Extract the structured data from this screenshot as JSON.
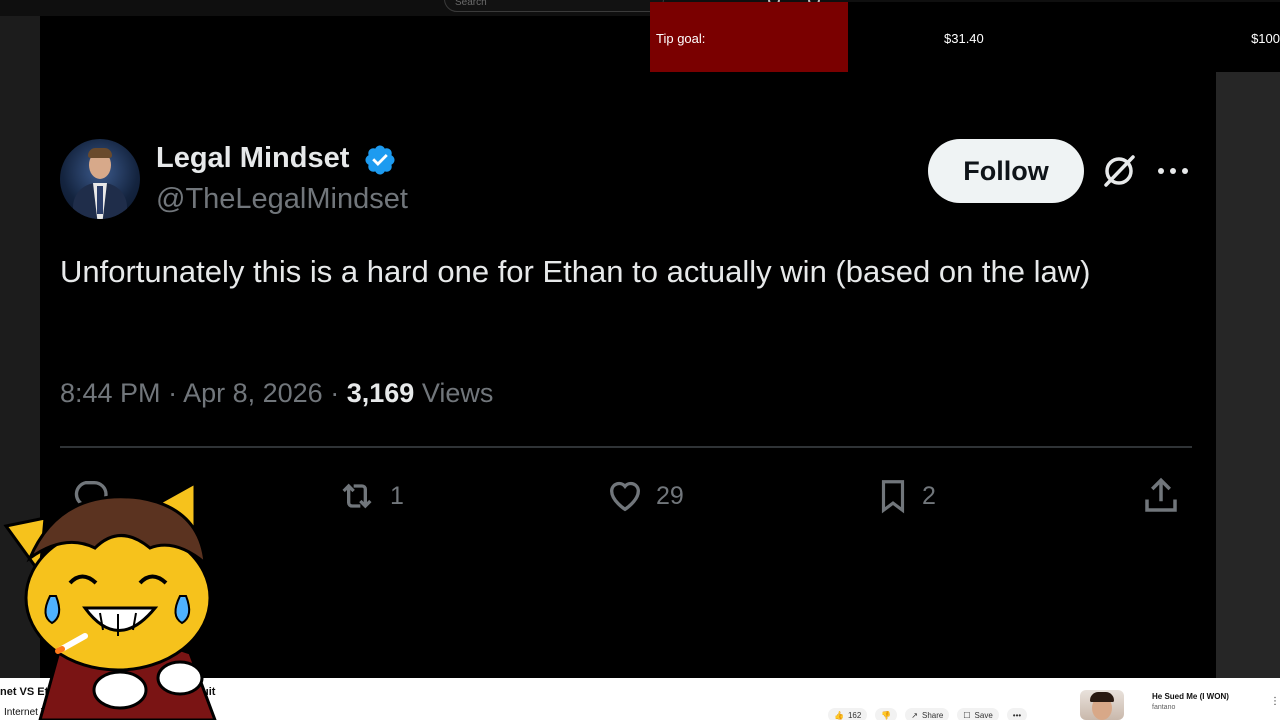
{
  "browser": {
    "search_placeholder": "Search"
  },
  "tip_goal": {
    "label": "Tip goal:",
    "current": "$31.40",
    "target": "$100",
    "progress": 0.314,
    "fill_color": "#7a0000"
  },
  "tweet": {
    "display_name": "Legal Mindset",
    "handle": "@TheLegalMindset",
    "verified": true,
    "follow_label": "Follow",
    "text": "Unfortunately this is a hard one for Ethan to actually win (based on the law)",
    "time": "8:44 PM",
    "separator": "·",
    "date": "Apr 8, 2026",
    "views_count": "3,169",
    "views_label": "Views",
    "actions": {
      "reply_icon": "reply-icon",
      "retweet_icon": "retweet-icon",
      "retweet_count": "1",
      "like_icon": "heart-icon",
      "like_count": "29",
      "bookmark_icon": "bookmark-icon",
      "bookmark_count": "2",
      "share_icon": "share-icon"
    },
    "accent_color": "#1d9bf0"
  },
  "youtube": {
    "video_title_start": "net VS Ethan",
    "video_title_end": "uit",
    "channel": "Internet VS",
    "like_count": "162",
    "share_label": "Share",
    "save_label": "Save",
    "rec_title": "He Sued Me (I WON)",
    "rec_channel": "fantano"
  }
}
